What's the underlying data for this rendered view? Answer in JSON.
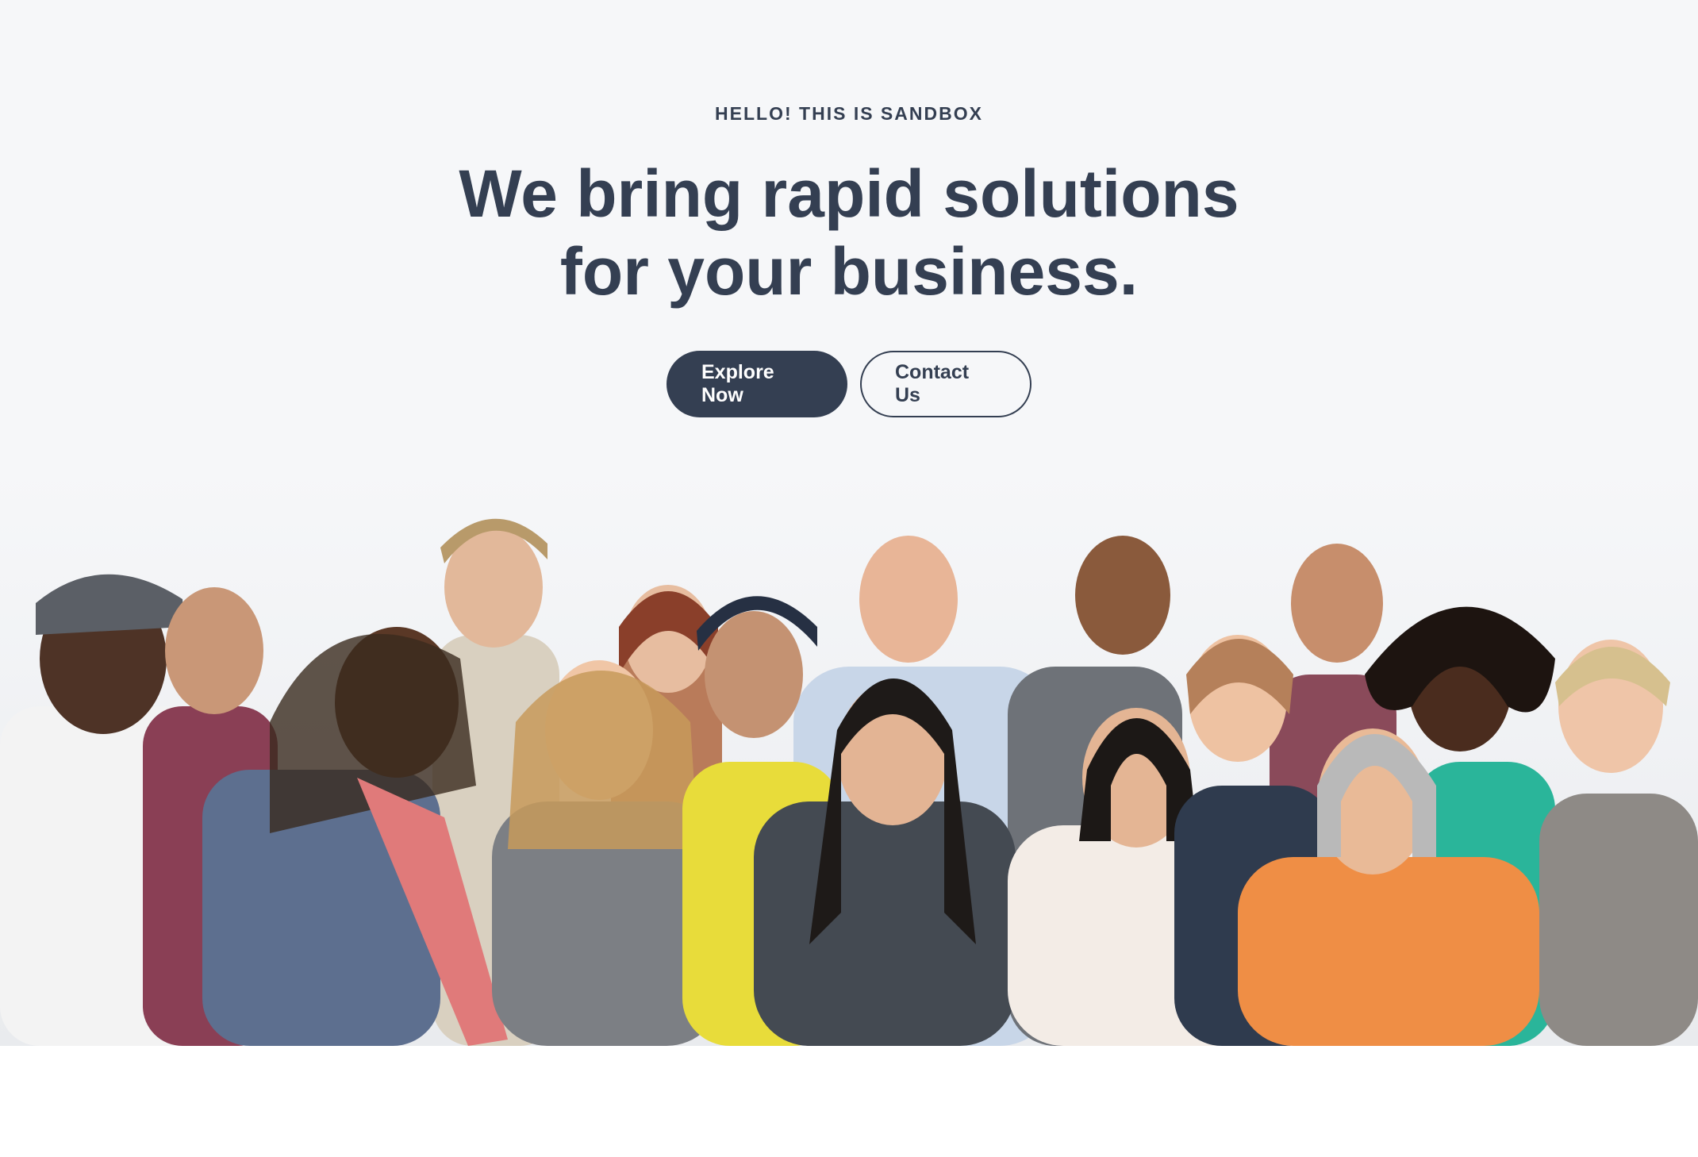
{
  "hero": {
    "eyebrow": "HELLO! THIS IS SANDBOX",
    "headline_line1": "We bring rapid solutions",
    "headline_line2": "for your business.",
    "primary_button": "Explore Now",
    "secondary_button": "Contact Us"
  },
  "colors": {
    "text": "#343f52",
    "background": "#f6f7f9",
    "primary": "#343f52"
  }
}
